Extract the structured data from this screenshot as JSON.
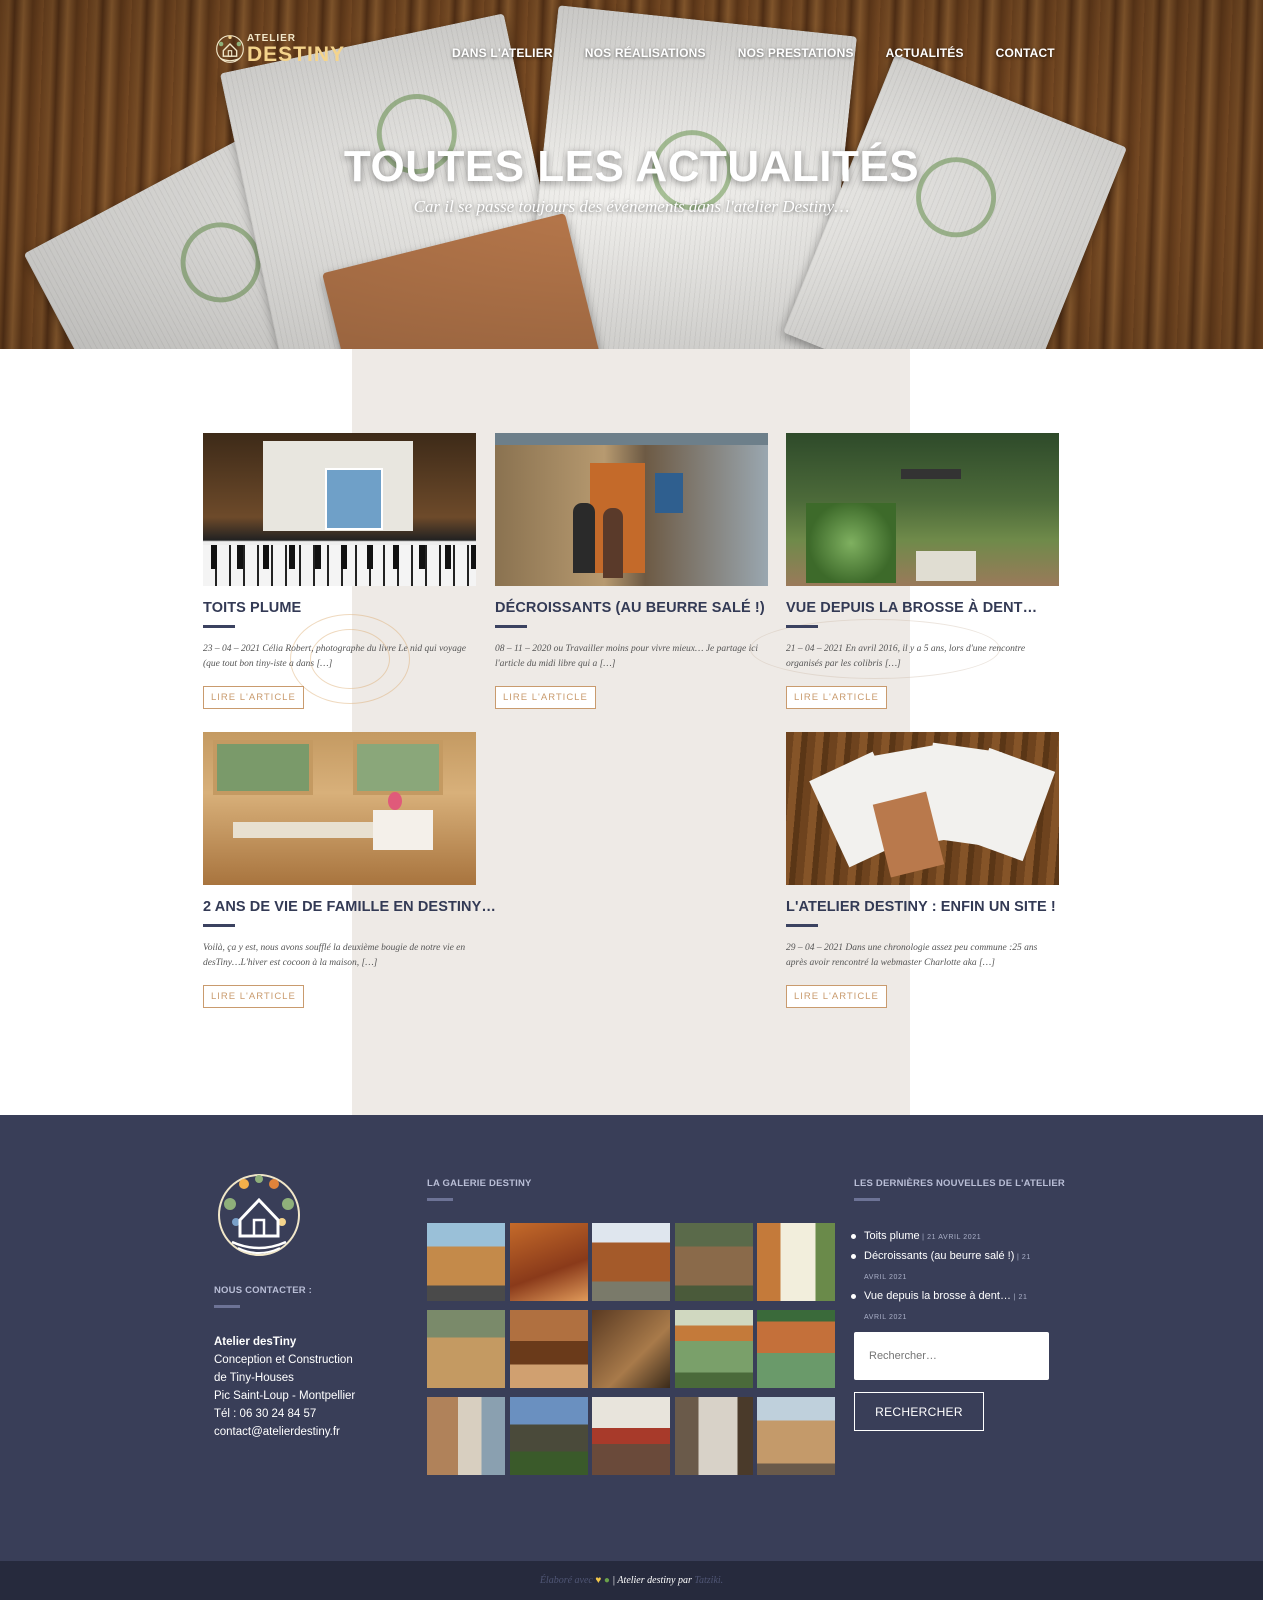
{
  "header": {
    "logo": {
      "small": "ATELIER",
      "big": "DESTINY"
    },
    "nav": [
      "DANS L'ATELIER",
      "NOS RÉALISATIONS",
      "NOS PRESTATIONS",
      "ACTUALITÉS",
      "CONTACT"
    ],
    "title": "TOUTES LES ACTUALITÉS",
    "subtitle": "Car il se passe toujours des événements dans l'atelier Destiny…"
  },
  "posts": [
    {
      "title": "TOITS PLUME",
      "excerpt": "23 – 04 – 2021 Célia Robert, photographe du livre Le nid qui voyage (que tout bon tiny-iste a dans […]",
      "button": "LIRE L'ARTICLE"
    },
    {
      "title": "DÉCROISSANTS (AU BEURRE SALÉ !)",
      "excerpt": "08 – 11 – 2020 ou Travailler moins pour vivre mieux… Je partage ici l'article du midi libre qui a […]",
      "button": "LIRE L'ARTICLE"
    },
    {
      "title": "VUE DEPUIS LA BROSSE À DENT…",
      "excerpt": "21 – 04 – 2021 En avril 2016, il y a 5 ans, lors d'une rencontre organisés par les colibris […]",
      "button": "LIRE L'ARTICLE"
    },
    {
      "title": "2 ANS DE VIE DE FAMILLE EN DESTINY…",
      "excerpt": "Voilà, ça y est, nous avons soufflé la deuxième bougie de notre vie en desTiny…L'hiver est cocoon à la maison, […]",
      "button": "LIRE L'ARTICLE"
    },
    {
      "title": "L'ATELIER DESTINY : ENFIN UN SITE !",
      "excerpt": "29 – 04 – 2021 Dans une chronologie assez peu commune :25 ans après avoir rencontré la webmaster Charlotte aka […]",
      "button": "LIRE L'ARTICLE"
    }
  ],
  "footer": {
    "contact_heading": "NOUS CONTACTER :",
    "contact": {
      "name": "Atelier desTiny",
      "line1": "Conception et Construction",
      "line2": "de Tiny-Houses",
      "line3": "Pic Saint-Loup - Montpellier",
      "phone": "Tél : 06 30 24 84 57",
      "email": "contact@atelierdestiny.fr"
    },
    "gallery_heading": "LA GALERIE DESTINY",
    "news_heading": "LES DERNIÈRES NOUVELLES DE L'ATELIER",
    "news": [
      {
        "title": "Toits plume",
        "date": "21 AVRIL 2021"
      },
      {
        "title": "Décroissants (au beurre salé !)",
        "date": "21 AVRIL 2021"
      },
      {
        "title": "Vue depuis la brosse à dent…",
        "date": "21 AVRIL 2021"
      }
    ],
    "search_placeholder": "Rechercher…",
    "search_button": "RECHERCHER"
  },
  "credits": {
    "made": "Élaboré avec",
    "site": "| Atelier destiny par",
    "author": "Tatziki."
  },
  "colors": {
    "footer_bg": "#393e58",
    "accent": "#c99b6e",
    "beige": "#eeeae6"
  }
}
